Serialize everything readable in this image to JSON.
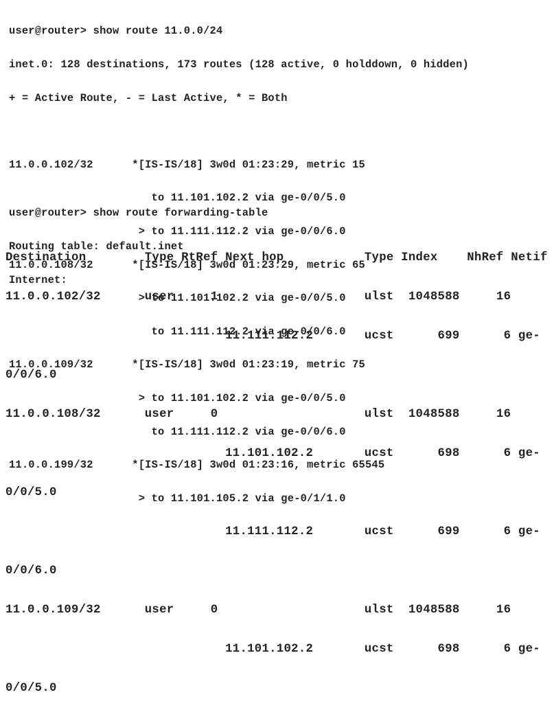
{
  "route_output": {
    "command": "user@router> show route 11.0.0/24",
    "summary": "inet.0: 128 destinations, 173 routes (128 active, 0 holddown, 0 hidden)",
    "legend": "+ = Active Route, - = Last Active, * = Both",
    "lines": [
      "11.0.0.102/32      *[IS-IS/18] 3w0d 01:23:29, metric 15",
      "                      to 11.101.102.2 via ge-0/0/5.0",
      "                    > to 11.111.112.2 via ge-0/0/6.0",
      "11.0.0.108/32      *[IS-IS/18] 3w0d 01:23:29, metric 65",
      "                    > to 11.101.102.2 via ge-0/0/5.0",
      "                      to 11.111.112.2 via ge-0/0/6.0",
      "11.0.0.109/32      *[IS-IS/18] 3w0d 01:23:19, metric 75",
      "                    > to 11.101.102.2 via ge-0/0/5.0",
      "                      to 11.111.112.2 via ge-0/0/6.0",
      "11.0.0.199/32      *[IS-IS/18] 3w0d 01:23:16, metric 65545",
      "                    > to 11.101.105.2 via ge-0/1/1.0"
    ]
  },
  "forwarding_output": {
    "command": "user@router> show route forwarding-table",
    "routing_table": "Routing table: default.inet",
    "family": "Internet:",
    "header": "Destination        Type RtRef Next hop           Type Index    NhRef Netif",
    "lines": [
      "11.0.0.102/32      user     1                    ulst  1048588     16",
      "                              11.111.112.2       ucst      699      6 ge-",
      "0/0/6.0",
      "11.0.0.108/32      user     0                    ulst  1048588     16",
      "                              11.101.102.2       ucst      698      6 ge-",
      "0/0/5.0",
      "                              11.111.112.2       ucst      699      6 ge-",
      "0/0/6.0",
      "11.0.0.109/32      user     0                    ulst  1048588     16",
      "                              11.101.102.2       ucst      698      6 ge-",
      "0/0/5.0"
    ]
  }
}
